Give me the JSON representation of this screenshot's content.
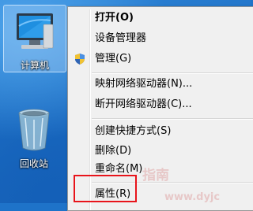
{
  "desktop": {
    "icons": [
      {
        "label": "计算机",
        "icon": "computer-icon",
        "selected": true
      },
      {
        "label": "回收站",
        "icon": "recycle-bin-icon",
        "selected": false
      }
    ]
  },
  "context_menu": {
    "items": [
      {
        "label": "打开(O)",
        "bold": true
      },
      {
        "label": "设备管理器"
      },
      {
        "label": "管理(G)",
        "icon": "uac-shield-icon"
      },
      {
        "label": "映射网络驱动器(N)..."
      },
      {
        "label": "断开网络驱动器(C)..."
      },
      {
        "label": "创建快捷方式(S)"
      },
      {
        "label": "删除(D)"
      },
      {
        "label": "重命名(M)"
      },
      {
        "label": "属性(R)"
      }
    ]
  },
  "watermark": {
    "text": "指南",
    "url": "www.dyjc"
  },
  "colors": {
    "highlight_border": "#e8141b",
    "menu_background": "#f0f0f0",
    "desktop_blue": "#1e73c9"
  }
}
